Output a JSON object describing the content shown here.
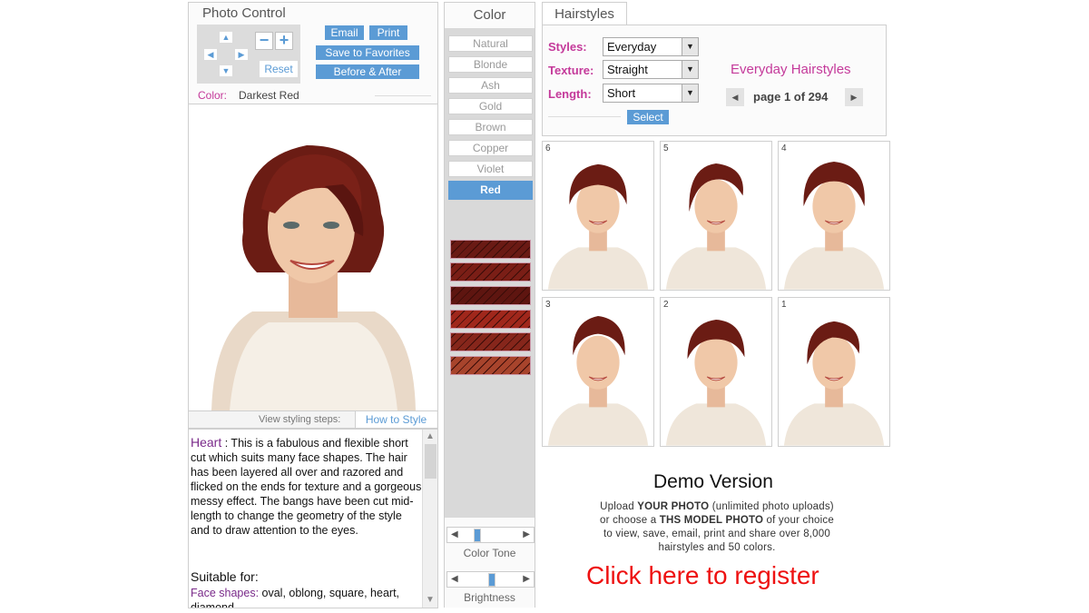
{
  "photo_control": {
    "title": "Photo Control",
    "reset_label": "Reset",
    "email_label": "Email",
    "print_label": "Print",
    "favorites_label": "Save to Favorites",
    "before_after_label": "Before & After",
    "color_label": "Color:",
    "color_value": "Darkest Red"
  },
  "steps": {
    "label": "View styling steps:",
    "how_to_style_label": "How to Style"
  },
  "description": {
    "face_type": "Heart",
    "text": " : This is a fabulous and flexible short cut which suits many face shapes. The hair has been layered all over and razored and flicked on the ends for texture and a gorgeous messy effect. The bangs have been cut mid-length to change the geometry of the style and to draw attention to the eyes.",
    "suitable_title": "Suitable for:",
    "face_shapes_label": "Face shapes:",
    "face_shapes_value": " oval, oblong, square, heart, diamond"
  },
  "color_panel": {
    "title": "Color",
    "options": [
      "Natural",
      "Blonde",
      "Ash",
      "Gold",
      "Brown",
      "Copper",
      "Violet",
      "Red"
    ],
    "selected": "Red",
    "swatch_colors": [
      "#6a1a14",
      "#7a1e16",
      "#5e1510",
      "#a0271b",
      "#86261b",
      "#a8442c"
    ],
    "tone_label": "Color Tone",
    "tone_level": 0.2,
    "brightness_label": "Brightness",
    "brightness_level": 0.5
  },
  "hairstyles": {
    "tab_label": "Hairstyles",
    "styles_label": "Styles:",
    "styles_value": "Everyday",
    "texture_label": "Texture:",
    "texture_value": "Straight",
    "length_label": "Length:",
    "length_value": "Short",
    "select_label": "Select",
    "heading": "Everyday Hairstyles",
    "page_text": "page 1 of 294",
    "thumbnails": [
      "6",
      "5",
      "4",
      "3",
      "2",
      "1"
    ]
  },
  "demo": {
    "title": "Demo Version",
    "line1_pre": "Upload ",
    "line1_bold": "YOUR PHOTO",
    "line1_post": " (unlimited photo uploads)",
    "line2_pre": "or choose a ",
    "line2_bold": "THS MODEL PHOTO",
    "line2_post": " of your choice",
    "line3": "to view, save, email, print and share over 8,000",
    "line4": "hairstyles and 50 colors.",
    "register_label": "Click here to register"
  },
  "colors": {
    "accent": "#5b9bd5",
    "magenta": "#c4399a",
    "register_red": "#ee1111",
    "hair": "#6b1c14"
  }
}
